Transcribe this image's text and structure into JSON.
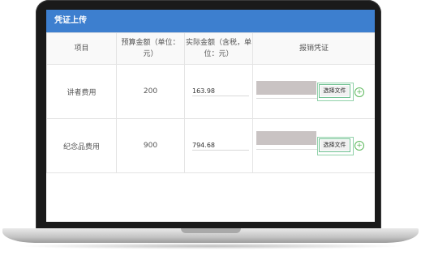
{
  "panel": {
    "title": "凭证上传"
  },
  "table": {
    "headers": [
      "项目",
      "预算金额（单位：元）",
      "实际金额（含税，单位：元）",
      "报销凭证"
    ],
    "rows": [
      {
        "item": "讲者费用",
        "budget": "200",
        "actual": "163.98",
        "file_button": "选择文件"
      },
      {
        "item": "纪念品费用",
        "budget": "900",
        "actual": "794.68",
        "file_button": "选择文件"
      }
    ]
  },
  "colors": {
    "header_bar": "#3d7fcf",
    "add_icon": "#5cb85c"
  },
  "icons": {
    "add": "plus-circle-icon"
  }
}
